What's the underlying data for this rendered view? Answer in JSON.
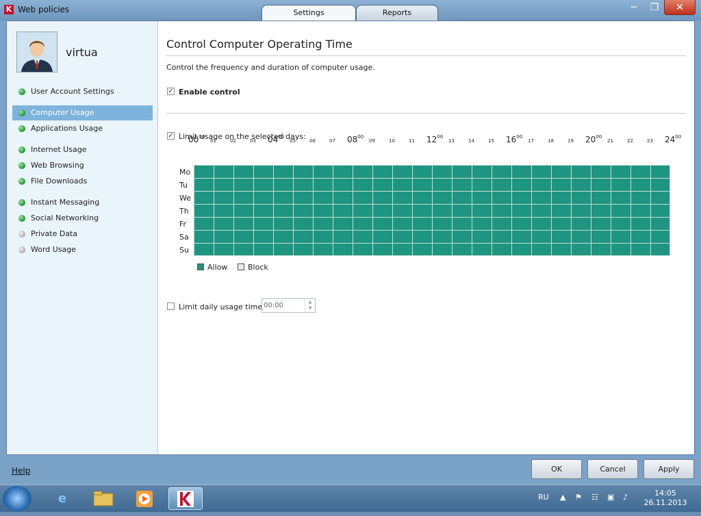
{
  "window": {
    "title": "Web policies",
    "app_icon": "K"
  },
  "tabs": [
    {
      "label": "Settings"
    },
    {
      "label": "Reports"
    }
  ],
  "user": {
    "name": "virtua"
  },
  "sidebar": {
    "items": [
      {
        "label": "User Account Settings",
        "status": "green"
      },
      {
        "label": "Computer Usage",
        "status": "green",
        "selected": true
      },
      {
        "label": "Applications Usage",
        "status": "green"
      },
      {
        "label": "Internet Usage",
        "status": "green"
      },
      {
        "label": "Web Browsing",
        "status": "green"
      },
      {
        "label": "File Downloads",
        "status": "green"
      },
      {
        "label": "Instant Messaging",
        "status": "green"
      },
      {
        "label": "Social Networking",
        "status": "green"
      },
      {
        "label": "Private Data",
        "status": "grey"
      },
      {
        "label": "Word Usage",
        "status": "grey"
      }
    ]
  },
  "main": {
    "title": "Control Computer Operating Time",
    "description": "Control the frequency and duration of computer usage.",
    "enable_control": {
      "label": "Enable control",
      "checked": true
    },
    "limit_days": {
      "label": "Limit usage on the selected days:",
      "checked": true
    },
    "schedule": {
      "hours_big": [
        "00",
        "04",
        "08",
        "12",
        "16",
        "20",
        "24"
      ],
      "hours_big_sup": "00",
      "hours_small": [
        "01",
        "02",
        "03",
        "05",
        "06",
        "07",
        "09",
        "10",
        "11",
        "13",
        "14",
        "15",
        "17",
        "18",
        "19",
        "21",
        "22",
        "23"
      ],
      "days": [
        "Mo",
        "Tu",
        "We",
        "Th",
        "Fr",
        "Sa",
        "Su"
      ],
      "all_allowed": true
    },
    "legend": {
      "allow": "Allow",
      "block": "Block",
      "allow_color": "#1e9580",
      "block_color": "#e8e8e8"
    },
    "limit_daily": {
      "label": "Limit daily usage time:",
      "checked": false,
      "value": "00:00"
    }
  },
  "footer": {
    "help": "Help",
    "ok": "OK",
    "cancel": "Cancel",
    "apply": "Apply"
  },
  "taskbar": {
    "lang": "RU",
    "time": "14:05",
    "date": "26.11.2013"
  }
}
